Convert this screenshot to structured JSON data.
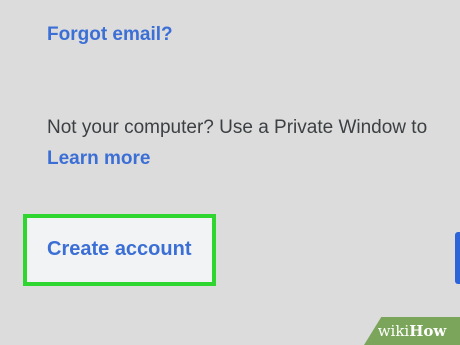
{
  "links": {
    "forgot_email": "Forgot email?",
    "learn_more": "Learn more",
    "create_account": "Create account"
  },
  "notice": "Not your computer? Use a Private Window to",
  "watermark": {
    "prefix": "wiki",
    "suffix": "How"
  },
  "colors": {
    "link": "#3b6fd6",
    "highlight": "#2fd62f",
    "background": "#dcdcdc",
    "button": "#2d64d8",
    "watermark": "#7aa55a"
  }
}
